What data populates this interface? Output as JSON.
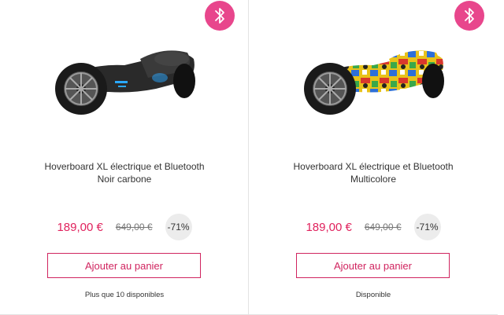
{
  "products": [
    {
      "title_line1": "Hoverboard XL électrique et Bluetooth",
      "title_line2": "Noir carbone",
      "price": "189,00 €",
      "old_price": "649,00 €",
      "discount": "-71%",
      "add_to_cart": "Ajouter au panier",
      "availability": "Plus que 10 disponibles",
      "badge_icon": "bluetooth-icon",
      "image_style": "carbon-black"
    },
    {
      "title_line1": "Hoverboard XL électrique et Bluetooth",
      "title_line2": "Multicolore",
      "price": "189,00 €",
      "old_price": "649,00 €",
      "discount": "-71%",
      "add_to_cart": "Ajouter au panier",
      "availability": "Disponible",
      "badge_icon": "bluetooth-icon",
      "image_style": "multicolor-graffiti"
    }
  ],
  "colors": {
    "accent": "#e0225d",
    "badge": "#e8468c",
    "discount_bg": "#ececec"
  }
}
